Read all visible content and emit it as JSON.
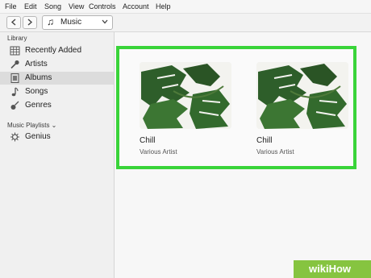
{
  "menu": [
    "File",
    "Edit",
    "Song",
    "View",
    "Controls",
    "Account",
    "Help"
  ],
  "toolbar": {
    "media_type": "Music"
  },
  "sidebar": {
    "library_header": "Library",
    "items": [
      {
        "label": "Recently Added",
        "icon": "grid-icon"
      },
      {
        "label": "Artists",
        "icon": "microphone-icon"
      },
      {
        "label": "Albums",
        "icon": "album-icon"
      },
      {
        "label": "Songs",
        "icon": "music-note-icon"
      },
      {
        "label": "Genres",
        "icon": "guitar-icon"
      }
    ],
    "playlists_header": "Music Playlists ⌄",
    "playlists": [
      {
        "label": "Genius",
        "icon": "genius-icon"
      }
    ]
  },
  "albums": [
    {
      "title": "Chill",
      "artist": "Various Artist"
    },
    {
      "title": "Chill",
      "artist": "Various Artist"
    }
  ],
  "watermark": "wikiHow",
  "colors": {
    "highlight": "#39d439",
    "selected_row": "#dcdcdc",
    "leaf": "#2f5f2a",
    "watermark_bg": "#86c440"
  }
}
